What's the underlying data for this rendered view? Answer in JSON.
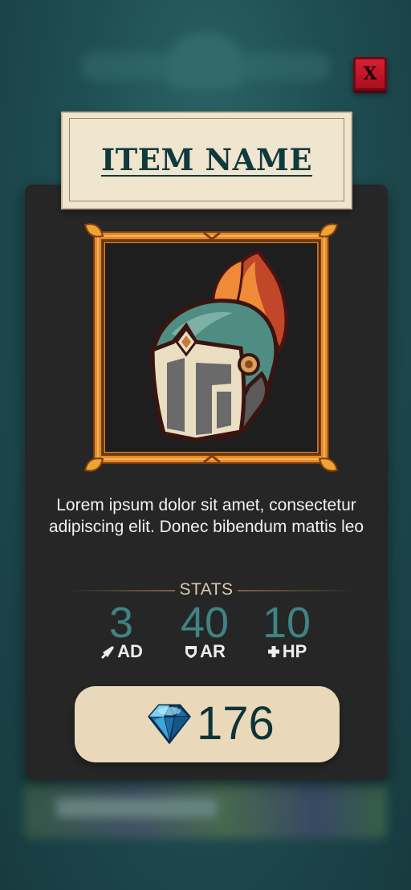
{
  "background": {
    "decor": "blurred-shop-screen"
  },
  "close_button": {
    "label": "X"
  },
  "item": {
    "name": "ITEM NAME",
    "icon": "knight-helmet-icon",
    "description": "Lorem ipsum dolor sit amet, consectetur adipiscing elit. Donec bibendum mattis leo"
  },
  "stats": {
    "title": "STATS",
    "items": [
      {
        "value": "3",
        "label": "AD",
        "icon": "sword-icon"
      },
      {
        "value": "40",
        "label": "AR",
        "icon": "shield-icon"
      },
      {
        "value": "10",
        "label": "HP",
        "icon": "plus-icon"
      }
    ]
  },
  "price": {
    "currency_icon": "diamond-gem-icon",
    "value": "176"
  },
  "colors": {
    "panel": "#262626",
    "plaque": "#f0e5cf",
    "accent_teal": "#3f8484",
    "frame_orange": "#e58a2a",
    "close_red": "#c4172a"
  }
}
